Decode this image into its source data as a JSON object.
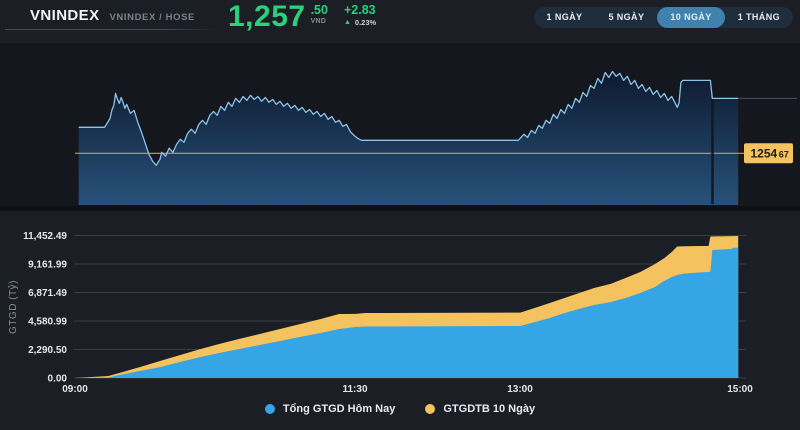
{
  "header": {
    "title": "VNINDEX",
    "subtitle": "VNINDEX / HOSE",
    "price": "1,257",
    "price_decimals": ".50",
    "currency": "VND",
    "change": "+2.83",
    "change_percent": "0.23%"
  },
  "icons": {
    "up_arrow": "▲"
  },
  "tabs": [
    {
      "label": "1 NGÀY",
      "active": false
    },
    {
      "label": "5 NGÀY",
      "active": false
    },
    {
      "label": "10 NGÀY",
      "active": true
    },
    {
      "label": "1 THÁNG",
      "active": false
    }
  ],
  "price_chart": {
    "previous_close_tag": {
      "main": "1254",
      "dec": "67"
    },
    "previous_close": 1254.67,
    "line_color": "#8cc3e6",
    "reference_color": "#c7a23f"
  },
  "volume_chart": {
    "ylabel": "GTGD (Tỷ)",
    "yticks": [
      "11,452.49",
      "9,161.99",
      "6,871.49",
      "4,580.99",
      "2,290.50",
      "0.00"
    ],
    "xticks": [
      "09:00",
      "11:30",
      "13:00",
      "15:00"
    ],
    "legend": [
      {
        "label": "Tổng GTGD Hôm Nay",
        "color": "#35a5e6"
      },
      {
        "label": "GTGDTB 10 Ngày",
        "color": "#f4c25f"
      }
    ]
  },
  "chart_data": [
    {
      "type": "line",
      "name": "price",
      "x_unit": "minutes_after_09:00",
      "x_range": [
        0,
        360
      ],
      "ylim": [
        1252.0,
        1260.0
      ],
      "reference_line": 1254.67,
      "last_value": 1257.5,
      "points": [
        [
          2,
          1256.01
        ],
        [
          10,
          1256.01
        ],
        [
          16,
          1256.01
        ],
        [
          17,
          1256.16
        ],
        [
          19,
          1256.47
        ],
        [
          20,
          1256.9
        ],
        [
          21,
          1257.14
        ],
        [
          22,
          1257.76
        ],
        [
          23,
          1257.45
        ],
        [
          24,
          1257.25
        ],
        [
          25,
          1257.55
        ],
        [
          26,
          1257.3
        ],
        [
          27,
          1256.99
        ],
        [
          28,
          1257.19
        ],
        [
          30,
          1256.73
        ],
        [
          32,
          1256.88
        ],
        [
          34,
          1256.27
        ],
        [
          36,
          1255.75
        ],
        [
          38,
          1255.19
        ],
        [
          40,
          1254.62
        ],
        [
          42,
          1254.26
        ],
        [
          44,
          1254.05
        ],
        [
          45,
          1254.21
        ],
        [
          46,
          1254.36
        ],
        [
          47,
          1254.72
        ],
        [
          49,
          1254.52
        ],
        [
          51,
          1254.93
        ],
        [
          53,
          1254.72
        ],
        [
          55,
          1255.13
        ],
        [
          57,
          1255.39
        ],
        [
          59,
          1255.24
        ],
        [
          61,
          1255.7
        ],
        [
          63,
          1255.91
        ],
        [
          65,
          1255.7
        ],
        [
          67,
          1256.16
        ],
        [
          69,
          1256.37
        ],
        [
          71,
          1256.16
        ],
        [
          73,
          1256.63
        ],
        [
          75,
          1256.83
        ],
        [
          77,
          1256.63
        ],
        [
          79,
          1257.09
        ],
        [
          81,
          1256.88
        ],
        [
          83,
          1257.3
        ],
        [
          85,
          1257.09
        ],
        [
          87,
          1257.5
        ],
        [
          89,
          1257.3
        ],
        [
          91,
          1257.6
        ],
        [
          93,
          1257.4
        ],
        [
          95,
          1257.66
        ],
        [
          97,
          1257.45
        ],
        [
          99,
          1257.6
        ],
        [
          101,
          1257.35
        ],
        [
          103,
          1257.55
        ],
        [
          105,
          1257.3
        ],
        [
          107,
          1257.45
        ],
        [
          109,
          1257.19
        ],
        [
          111,
          1257.35
        ],
        [
          113,
          1257.09
        ],
        [
          115,
          1257.25
        ],
        [
          117,
          1256.99
        ],
        [
          119,
          1257.14
        ],
        [
          121,
          1256.88
        ],
        [
          123,
          1257.04
        ],
        [
          125,
          1256.78
        ],
        [
          127,
          1256.93
        ],
        [
          129,
          1256.68
        ],
        [
          131,
          1256.83
        ],
        [
          133,
          1256.57
        ],
        [
          135,
          1256.73
        ],
        [
          137,
          1256.42
        ],
        [
          139,
          1256.57
        ],
        [
          141,
          1256.27
        ],
        [
          143,
          1256.37
        ],
        [
          145,
          1256.06
        ],
        [
          147,
          1256.16
        ],
        [
          149,
          1255.8
        ],
        [
          151,
          1255.6
        ],
        [
          153,
          1255.44
        ],
        [
          155,
          1255.34
        ],
        [
          240,
          1255.34
        ],
        [
          243,
          1255.65
        ],
        [
          245,
          1255.49
        ],
        [
          247,
          1255.85
        ],
        [
          249,
          1255.7
        ],
        [
          251,
          1256.11
        ],
        [
          253,
          1255.96
        ],
        [
          255,
          1256.37
        ],
        [
          257,
          1256.21
        ],
        [
          259,
          1256.68
        ],
        [
          261,
          1256.47
        ],
        [
          263,
          1256.93
        ],
        [
          265,
          1256.73
        ],
        [
          267,
          1257.19
        ],
        [
          269,
          1256.99
        ],
        [
          271,
          1257.5
        ],
        [
          273,
          1257.3
        ],
        [
          275,
          1257.81
        ],
        [
          277,
          1257.6
        ],
        [
          279,
          1258.17
        ],
        [
          281,
          1258.02
        ],
        [
          283,
          1258.53
        ],
        [
          285,
          1258.28
        ],
        [
          287,
          1258.84
        ],
        [
          289,
          1258.58
        ],
        [
          291,
          1258.89
        ],
        [
          293,
          1258.64
        ],
        [
          295,
          1258.79
        ],
        [
          297,
          1258.43
        ],
        [
          299,
          1258.64
        ],
        [
          301,
          1258.22
        ],
        [
          303,
          1258.43
        ],
        [
          305,
          1258.02
        ],
        [
          307,
          1258.22
        ],
        [
          309,
          1257.86
        ],
        [
          311,
          1258.07
        ],
        [
          313,
          1257.71
        ],
        [
          315,
          1257.91
        ],
        [
          317,
          1257.55
        ],
        [
          319,
          1257.76
        ],
        [
          321,
          1257.4
        ],
        [
          323,
          1257.6
        ],
        [
          325,
          1257.25
        ],
        [
          326,
          1257.04
        ],
        [
          327,
          1257.25
        ],
        [
          328,
          1258.33
        ],
        [
          329,
          1258.43
        ],
        [
          344,
          1258.43
        ],
        [
          345,
          1257.5
        ],
        [
          359,
          1257.5
        ]
      ]
    },
    {
      "type": "area",
      "name": "turnover",
      "ylabel": "GTGD (Tỷ)",
      "ymax": 11452.49,
      "yticks": [
        0.0,
        2290.5,
        4580.99,
        6871.49,
        9161.99,
        11452.49
      ],
      "xticks": [
        "09:00",
        "11:30",
        "13:00",
        "15:00"
      ],
      "x_unit": "minutes_after_09:00",
      "series": [
        {
          "name": "GTGDTB 10 Ngày",
          "color": "#f4c25f",
          "points": [
            [
              0,
              0
            ],
            [
              18,
              160
            ],
            [
              24,
              400
            ],
            [
              35,
              880
            ],
            [
              46,
              1370
            ],
            [
              57,
              1850
            ],
            [
              68,
              2330
            ],
            [
              78,
              2730
            ],
            [
              89,
              3140
            ],
            [
              100,
              3540
            ],
            [
              111,
              3940
            ],
            [
              122,
              4340
            ],
            [
              133,
              4740
            ],
            [
              143,
              5140
            ],
            [
              152,
              5150
            ],
            [
              157,
              5220
            ],
            [
              241,
              5260
            ],
            [
              249,
              5630
            ],
            [
              257,
              6030
            ],
            [
              265,
              6430
            ],
            [
              273,
              6830
            ],
            [
              281,
              7230
            ],
            [
              290,
              7560
            ],
            [
              298,
              8040
            ],
            [
              306,
              8520
            ],
            [
              314,
              9160
            ],
            [
              319,
              9640
            ],
            [
              323,
              10130
            ],
            [
              326,
              10570
            ],
            [
              330,
              10590
            ],
            [
              338,
              10610
            ],
            [
              343,
              10610
            ],
            [
              344,
              11370
            ],
            [
              359,
              11410
            ]
          ]
        },
        {
          "name": "Tổng GTGD Hôm Nay",
          "color": "#35a5e6",
          "points": [
            [
              0,
              0
            ],
            [
              18,
              40
            ],
            [
              24,
              240
            ],
            [
              35,
              560
            ],
            [
              46,
              880
            ],
            [
              57,
              1290
            ],
            [
              68,
              1690
            ],
            [
              78,
              2010
            ],
            [
              89,
              2330
            ],
            [
              100,
              2650
            ],
            [
              111,
              2970
            ],
            [
              122,
              3300
            ],
            [
              133,
              3620
            ],
            [
              143,
              3940
            ],
            [
              152,
              4100
            ],
            [
              157,
              4140
            ],
            [
              241,
              4180
            ],
            [
              249,
              4500
            ],
            [
              257,
              4820
            ],
            [
              265,
              5220
            ],
            [
              273,
              5550
            ],
            [
              281,
              5870
            ],
            [
              290,
              6110
            ],
            [
              298,
              6430
            ],
            [
              306,
              6830
            ],
            [
              314,
              7310
            ],
            [
              319,
              7800
            ],
            [
              323,
              8120
            ],
            [
              326,
              8280
            ],
            [
              330,
              8400
            ],
            [
              338,
              8480
            ],
            [
              343,
              8520
            ],
            [
              344,
              8540
            ],
            [
              345,
              10290
            ],
            [
              355,
              10370
            ],
            [
              357,
              10470
            ],
            [
              359,
              10470
            ]
          ]
        }
      ]
    }
  ]
}
